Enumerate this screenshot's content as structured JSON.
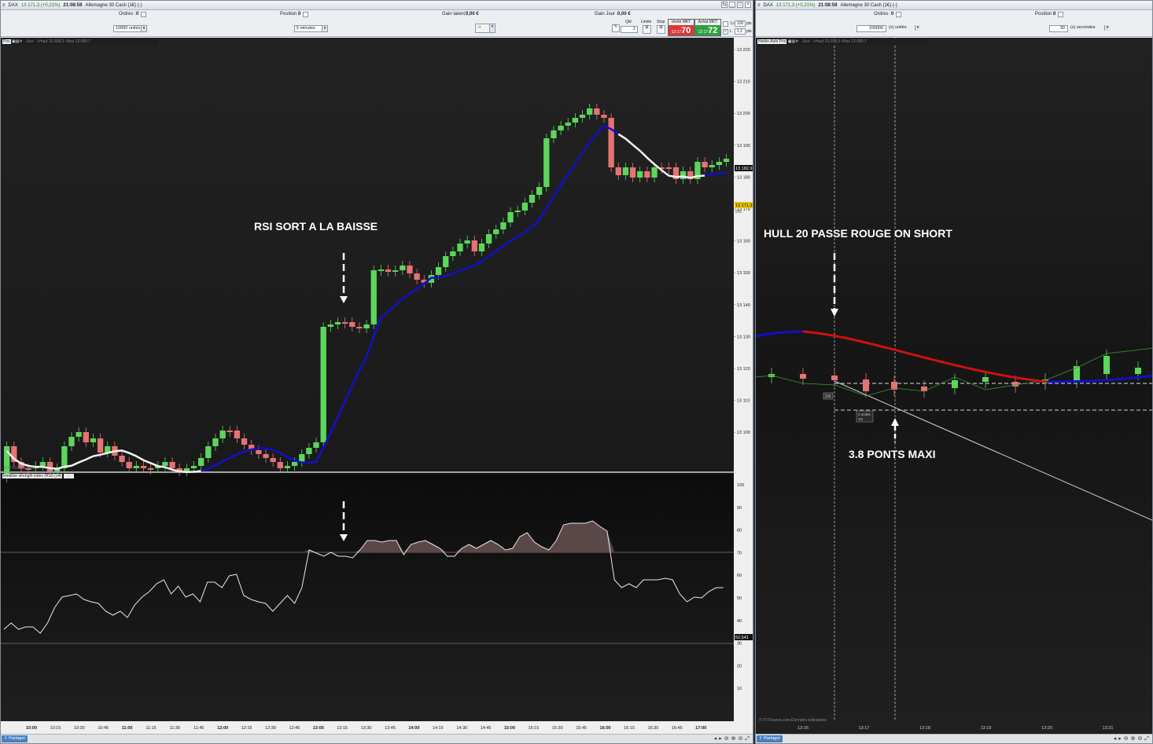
{
  "left": {
    "title": {
      "instrument": "DAX",
      "quote": "13 171,3 (+0,21%)",
      "time": "21:08:59",
      "name": "Allemagne 30 Cash (1€) (-)"
    },
    "order_bar": {
      "orders_label": "Ordres :",
      "orders_value": "0",
      "position_label": "Position :",
      "position_value": "0",
      "latent_label": "Gain latent :",
      "latent_value": "0,00 €",
      "jour_label": "Gain Jour :",
      "jour_value": "0,00 €",
      "units_value": "10000 unités",
      "timeframe_value": "5 minutes",
      "qte_label": "Qté",
      "qte_value": "1",
      "limite_label": "Limite",
      "stop_label": "Stop",
      "vente_label": "Vente MKT",
      "vente_prefix": "13 17",
      "vente_value": "70",
      "achat_label": "Achat MKT",
      "achat_prefix": "13 17",
      "achat_value": "72",
      "sp_label": "Sp",
      "sp_value1": "100",
      "sp_unit1": "pts",
      "sp_value2": "1,2",
      "sp_unit2": "pts",
      "l_label": "L"
    },
    "price_chart": {
      "header_tag": "Prix",
      "header_meta": "Jour : +Haut 13 208,3 +Bas 13 080,7",
      "annotation": "RSI SORT A LA BAISSE",
      "y_ticks": [
        "13 220",
        "13 210",
        "13 200",
        "13 190",
        "13 180",
        "13 170",
        "13 160",
        "13 150",
        "13 140",
        "13 130",
        "13 120",
        "13 110",
        "13 100"
      ],
      "last_price": "13 182,9",
      "bid_price": "13 171,3",
      "bid_pct": "60s",
      "watermark": "© IT-Finance.com"
    },
    "rsi_chart": {
      "header_tag": "Relative strength index (RSI) (14)",
      "y_ticks": [
        "100",
        "90",
        "80",
        "70",
        "60",
        "50",
        "40",
        "30",
        "20",
        "10"
      ],
      "last_value": "52,541"
    },
    "x_ticks": [
      "10:00",
      "10:15",
      "10:30",
      "10:45",
      "11:00",
      "11:15",
      "11:30",
      "11:45",
      "12:00",
      "12:15",
      "12:30",
      "12:45",
      "13:00",
      "13:15",
      "13:30",
      "13:45",
      "14:00",
      "14:15",
      "14:30",
      "14:45",
      "15:00",
      "15:15",
      "15:30",
      "15:45",
      "16:00",
      "16:15",
      "16:30",
      "16:45",
      "17:00"
    ],
    "bold_x_ticks": [
      "10:00",
      "11:00",
      "12:00",
      "13:00",
      "14:00",
      "15:00",
      "16:00",
      "17:00"
    ],
    "share_label": "Partager"
  },
  "right": {
    "title": {
      "instrument": "DAX",
      "quote": "13 171,3 (+0,21%)",
      "time": "21:08:59",
      "name": "Allemagne 30 Cash (1€) (-)"
    },
    "order_bar": {
      "orders_label": "Ordres :",
      "orders_value": "0",
      "position_label": "Position :",
      "position_value": "0",
      "units_value": "100000",
      "units_type": "(x) unités",
      "seconds_value": "30",
      "seconds_type": "(x) secondes"
    },
    "chart": {
      "header_tag": "Heikin-Ashi Prix",
      "header_meta": "Jour : +Haut 13 208,3 +Bas 13 080,7",
      "annotation_top": "HULL 20 PASSE ROUGE ON SHORT",
      "annotation_bottom": "3.8 PONTS MAXI",
      "order_tag": "3.8",
      "box_line1": "2 unités",
      "box_line2": "1m",
      "watermark": "© IT-Finance.com  Données indicatives",
      "x_ticks": [
        "13:16",
        "13:17",
        "13:18",
        "13:19",
        "13:20",
        "13:21"
      ]
    },
    "share_label": "Partager"
  },
  "colors": {
    "up": "#5cd65c",
    "down": "#e57373",
    "hull_blue": "#1010c8",
    "hull_red": "#d01010",
    "bg": "#1b1b1b"
  }
}
